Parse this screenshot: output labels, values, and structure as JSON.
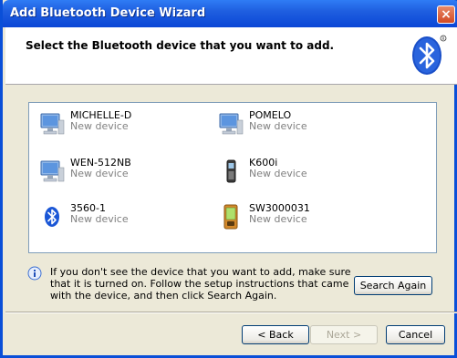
{
  "window": {
    "title": "Add Bluetooth Device Wizard",
    "close_label": "×"
  },
  "header": {
    "instruction": "Select the Bluetooth device that you want to add."
  },
  "devices": [
    {
      "name": "MICHELLE-D",
      "status": "New device",
      "icon": "computer-icon"
    },
    {
      "name": "POMELO",
      "status": "New device",
      "icon": "computer-icon"
    },
    {
      "name": "WEN-512NB",
      "status": "New device",
      "icon": "computer-icon"
    },
    {
      "name": "K600i",
      "status": "New device",
      "icon": "phone-icon"
    },
    {
      "name": "3560-1",
      "status": "New device",
      "icon": "bluetooth-icon"
    },
    {
      "name": "SW3000031",
      "status": "New device",
      "icon": "pda-icon"
    }
  ],
  "info": {
    "text": "If you don't see the device that you want to add, make sure that it is turned on. Follow the setup instructions that came with the device, and then click Search Again."
  },
  "buttons": {
    "search_again": "Search Again",
    "back": "< Back",
    "next": "Next >",
    "cancel": "Cancel"
  }
}
